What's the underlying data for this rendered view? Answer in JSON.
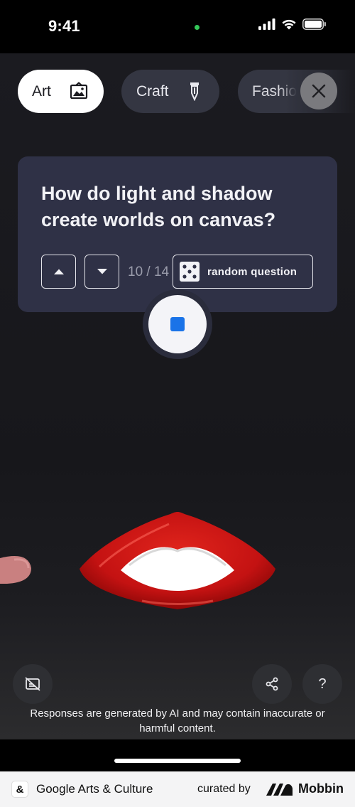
{
  "status_bar": {
    "time": "9:41"
  },
  "chips": [
    {
      "label": "Art",
      "icon": "framed-picture-icon"
    },
    {
      "label": "Craft",
      "icon": "pencil-tool-icon"
    },
    {
      "label": "Fashio",
      "icon": ""
    }
  ],
  "question_card": {
    "question": "How do light and shadow create worlds on canvas?",
    "counter": "10 / 14",
    "random_label": "random question"
  },
  "disclaimer": "Responses are generated by AI and may contain inaccurate or harmful content.",
  "footer": {
    "app_name": "Google Arts & Culture",
    "curated_by": "curated by",
    "brand": "Mobbin"
  },
  "colors": {
    "card_bg": "#2f3146",
    "chip_bg": "#343642",
    "stop_blue": "#1a73e8",
    "lips_red": "#cc1414"
  }
}
